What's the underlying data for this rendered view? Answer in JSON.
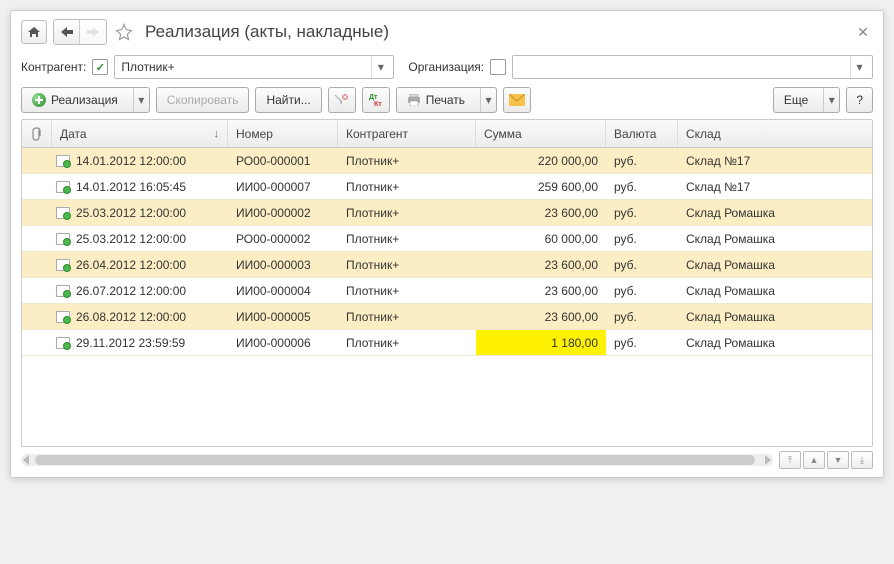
{
  "title": "Реализация (акты, накладные)",
  "filters": {
    "contractor_label": "Контрагент:",
    "contractor_value": "Плотник+",
    "org_label": "Организация:",
    "org_value": ""
  },
  "toolbar": {
    "create_label": "Реализация",
    "copy_label": "Скопировать",
    "find_label": "Найти...",
    "print_label": "Печать",
    "more_label": "Еще",
    "help_label": "?"
  },
  "columns": {
    "date": "Дата",
    "number": "Номер",
    "agent": "Контрагент",
    "sum": "Сумма",
    "currency": "Валюта",
    "store": "Склад"
  },
  "rows": [
    {
      "date": "14.01.2012 12:00:00",
      "number": "РО00-000001",
      "agent": "Плотник+",
      "sum": "220 000,00",
      "currency": "руб.",
      "store": "Склад №17",
      "hl": false
    },
    {
      "date": "14.01.2012 16:05:45",
      "number": "ИИ00-000007",
      "agent": "Плотник+",
      "sum": "259 600,00",
      "currency": "руб.",
      "store": "Склад №17",
      "hl": false
    },
    {
      "date": "25.03.2012 12:00:00",
      "number": "ИИ00-000002",
      "agent": "Плотник+",
      "sum": "23 600,00",
      "currency": "руб.",
      "store": "Склад Ромашка",
      "hl": false
    },
    {
      "date": "25.03.2012 12:00:00",
      "number": "РО00-000002",
      "agent": "Плотник+",
      "sum": "60 000,00",
      "currency": "руб.",
      "store": "Склад Ромашка",
      "hl": false
    },
    {
      "date": "26.04.2012 12:00:00",
      "number": "ИИ00-000003",
      "agent": "Плотник+",
      "sum": "23 600,00",
      "currency": "руб.",
      "store": "Склад Ромашка",
      "hl": false
    },
    {
      "date": "26.07.2012 12:00:00",
      "number": "ИИ00-000004",
      "agent": "Плотник+",
      "sum": "23 600,00",
      "currency": "руб.",
      "store": "Склад Ромашка",
      "hl": false
    },
    {
      "date": "26.08.2012 12:00:00",
      "number": "ИИ00-000005",
      "agent": "Плотник+",
      "sum": "23 600,00",
      "currency": "руб.",
      "store": "Склад Ромашка",
      "hl": false
    },
    {
      "date": "29.11.2012 23:59:59",
      "number": "ИИ00-000006",
      "agent": "Плотник+",
      "sum": "1 180,00",
      "currency": "руб.",
      "store": "Склад Ромашка",
      "hl": true
    }
  ]
}
